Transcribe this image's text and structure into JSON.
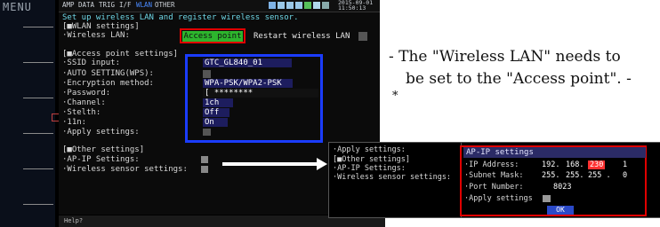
{
  "device": {
    "menu_label": "MENU",
    "top_tabs": [
      "AMP",
      "DATA",
      "TRIG",
      "I/F",
      "WLAN",
      "OTHER"
    ],
    "active_tab": "WLAN",
    "date": "2015-09-01",
    "time": "11:50:13",
    "screen_title": "Set up wireless LAN and register wireless sensor.",
    "wlan_settings_header": "[■WLAN settings]",
    "wireless_lan_label": "·Wireless LAN:",
    "wireless_lan_value": "Access point",
    "restart_label": "Restart wireless LAN",
    "ap_settings_header": "[■Access point settings]",
    "ssid_label": "·SSID input:",
    "ssid_value": "GTC_GL840_01",
    "auto_setting_label": "·AUTO SETTING(WPS):",
    "encryption_label": "·Encryption method:",
    "encryption_value": "WPA-PSK/WPA2-PSK",
    "password_label": "·Password:",
    "password_value": "[ ********",
    "channel_label": "·Channel:",
    "channel_value": "1ch",
    "stealth_label": "·Stelth:",
    "stealth_value": "Off",
    "n11_label": "·11n:",
    "n11_value": "On",
    "apply_label": "·Apply settings:",
    "other_header": "[■Other settings]",
    "ap_ip_label": "·AP-IP Settings:",
    "sensor_label": "·Wireless sensor settings:",
    "help_text": "Help?"
  },
  "note": {
    "line1": "- The \"Wireless LAN\" needs to",
    "line2": "be set to the \"Access point\". -",
    "line3": "*"
  },
  "zoom": {
    "apply_label": "·Apply settings:",
    "other_header": "[■Other settings]",
    "ap_ip_label": "·AP-IP Settings:",
    "sensor_label": "·Wireless sensor settings:",
    "panel_title": "AP-IP settings",
    "ip_label": "·IP Address:",
    "ip_1": "192.",
    "ip_2": "168.",
    "ip_3": "230",
    "ip_4": "1",
    "mask_label": "·Subnet Mask:",
    "mask_1": "255.",
    "mask_2": "255.",
    "mask_3": "255 .",
    "mask_4": "0",
    "port_label": "·Port Number:",
    "port_value": "8023",
    "apply_label2": "·Apply settings",
    "ok_label": "OK"
  }
}
